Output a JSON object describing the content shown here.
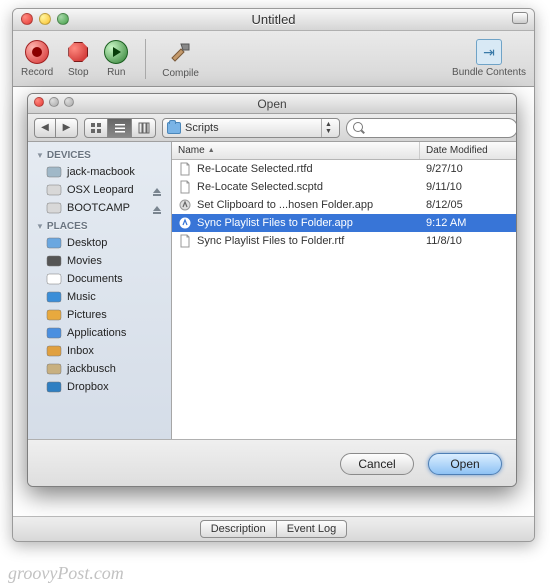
{
  "main_window": {
    "title": "Untitled",
    "toolbar": {
      "record": "Record",
      "stop": "Stop",
      "run": "Run",
      "compile": "Compile",
      "bundle": "Bundle Contents"
    },
    "footer": {
      "description": "Description",
      "event_log": "Event Log"
    }
  },
  "dialog": {
    "title": "Open",
    "path": "Scripts",
    "search_placeholder": "",
    "sidebar": {
      "devices_header": "DEVICES",
      "devices": [
        {
          "icon": "imac",
          "label": "jack-macbook"
        },
        {
          "icon": "hdd",
          "label": "OSX Leopard"
        },
        {
          "icon": "hdd",
          "label": "BOOTCAMP"
        }
      ],
      "places_header": "PLACES",
      "places": [
        {
          "icon": "desktop",
          "label": "Desktop"
        },
        {
          "icon": "movies",
          "label": "Movies"
        },
        {
          "icon": "docs",
          "label": "Documents"
        },
        {
          "icon": "music",
          "label": "Music"
        },
        {
          "icon": "pics",
          "label": "Pictures"
        },
        {
          "icon": "apps",
          "label": "Applications"
        },
        {
          "icon": "inbox",
          "label": "Inbox"
        },
        {
          "icon": "home",
          "label": "jackbusch"
        },
        {
          "icon": "dropbox",
          "label": "Dropbox"
        }
      ]
    },
    "columns": {
      "name": "Name",
      "date": "Date Modified"
    },
    "files": [
      {
        "icon": "rtfd",
        "name": "Re-Locate Selected.rtfd",
        "date": "9/27/10",
        "sel": false
      },
      {
        "icon": "scptd",
        "name": "Re-Locate Selected.scptd",
        "date": "9/11/10",
        "sel": false
      },
      {
        "icon": "app",
        "name": "Set Clipboard to ...hosen Folder.app",
        "date": "8/12/05",
        "sel": false
      },
      {
        "icon": "app",
        "name": "Sync Playlist Files to Folder.app",
        "date": "9:12 AM",
        "sel": true
      },
      {
        "icon": "rtf",
        "name": "Sync Playlist Files to Folder.rtf",
        "date": "11/8/10",
        "sel": false
      }
    ],
    "buttons": {
      "cancel": "Cancel",
      "open": "Open"
    }
  },
  "watermark": "groovyPost.com"
}
